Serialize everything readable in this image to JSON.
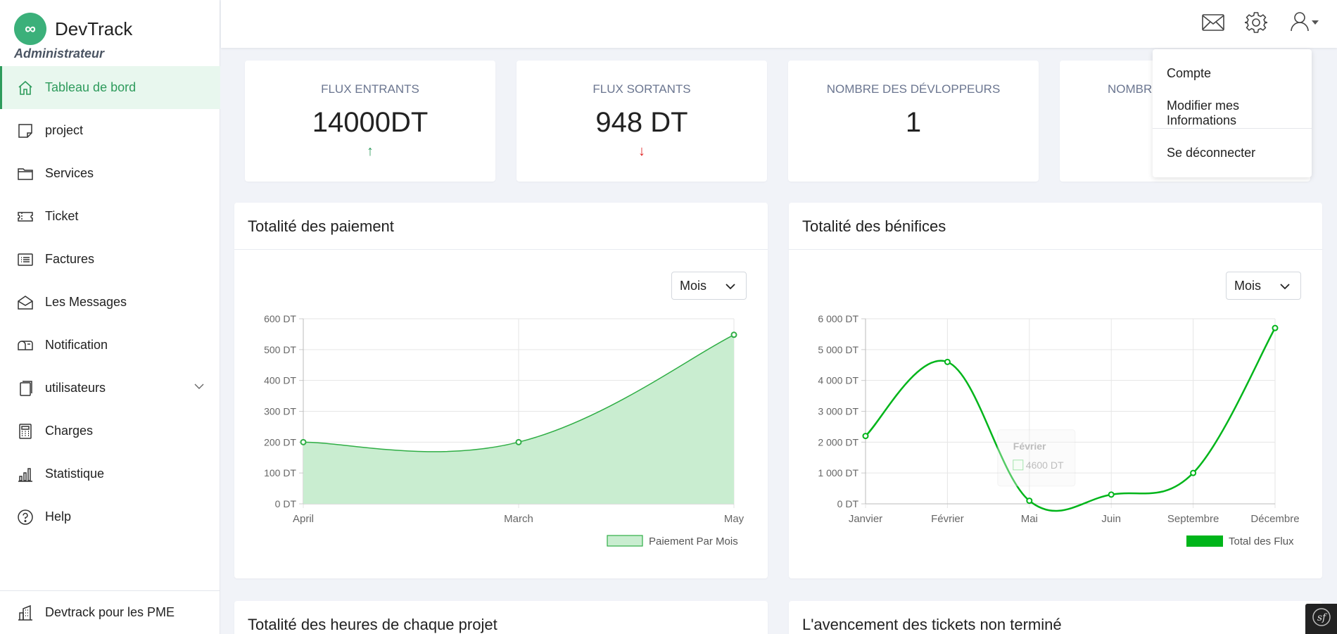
{
  "brand": {
    "name": "DevTrack",
    "role": "Administrateur",
    "logo_glyph": "∞",
    "accent": "#3bb07a"
  },
  "nav": [
    {
      "label": "Tableau de bord",
      "icon": "home-icon",
      "active": true
    },
    {
      "label": "project",
      "icon": "sticky-note-icon"
    },
    {
      "label": "Services",
      "icon": "folder-icon"
    },
    {
      "label": "Ticket",
      "icon": "ticket-icon"
    },
    {
      "label": "Factures",
      "icon": "list-icon"
    },
    {
      "label": "Les Messages",
      "icon": "envelope-open-icon"
    },
    {
      "label": "Notification",
      "icon": "mailbox-icon"
    },
    {
      "label": "utilisateurs",
      "icon": "files-icon",
      "has_chevron": true
    },
    {
      "label": "Charges",
      "icon": "calculator-icon"
    },
    {
      "label": "Statistique",
      "icon": "bar-chart-icon"
    },
    {
      "label": "Help",
      "icon": "question-circle-icon"
    }
  ],
  "sidebar_footer": {
    "label": "Devtrack pour les PME",
    "icon": "building-icon"
  },
  "topbar": {
    "icons": [
      "mail-icon",
      "gear-icon",
      "user-icon"
    ]
  },
  "user_menu": {
    "items": [
      "Compte",
      "Modifier mes Informations"
    ],
    "logout": "Se déconnecter"
  },
  "stats": [
    {
      "label": "FLUX ENTRANTS",
      "value": "14000DT",
      "arrow": "↑",
      "arrow_color": "#2e9b5c"
    },
    {
      "label": "FLUX SORTANTS",
      "value": "948 DT",
      "arrow": "↓",
      "arrow_color": "#e02424"
    },
    {
      "label": "NOMBRE DES DÉVLOPPEURS",
      "value": "1",
      "arrow": ""
    },
    {
      "label": "NOMBR",
      "value": "",
      "arrow": ""
    }
  ],
  "panels": {
    "payments": {
      "title": "Totalité des paiement",
      "select": "Mois"
    },
    "benefits": {
      "title": "Totalité des bénifices",
      "select": "Mois"
    },
    "hours": {
      "title": "Totalité des heures de chaque projet"
    },
    "tickets": {
      "title": "L'avencement des tickets non terminé"
    }
  },
  "chart_data": [
    {
      "type": "area",
      "title": "Totalité des paiement",
      "categories": [
        "April",
        "March",
        "May"
      ],
      "series": [
        {
          "name": "Paiement Par Mois",
          "values": [
            200,
            200,
            548
          ]
        }
      ],
      "ylim": [
        0,
        600
      ],
      "yticks": [
        "0 DT",
        "100 DT",
        "200 DT",
        "300 DT",
        "400 DT",
        "500 DT",
        "600 DT"
      ],
      "grid": true,
      "legend": "bottom-right",
      "color": "#2fae45",
      "fill": "#c9edd0"
    },
    {
      "type": "line",
      "title": "Totalité des bénifices",
      "categories": [
        "Janvier",
        "Février",
        "Mai",
        "Juin",
        "Septembre",
        "Décembre"
      ],
      "series": [
        {
          "name": "Total des Flux",
          "values": [
            2200,
            4600,
            100,
            300,
            1000,
            5700
          ]
        }
      ],
      "ylim": [
        0,
        6000
      ],
      "yticks": [
        "0 DT",
        "1 000 DT",
        "2 000 DT",
        "3 000 DT",
        "4 000 DT",
        "5 000 DT",
        "6 000 DT"
      ],
      "grid": true,
      "legend": "bottom-right",
      "color": "#00b51a",
      "tooltip": {
        "title": "Février",
        "value": "4600 DT"
      }
    }
  ]
}
